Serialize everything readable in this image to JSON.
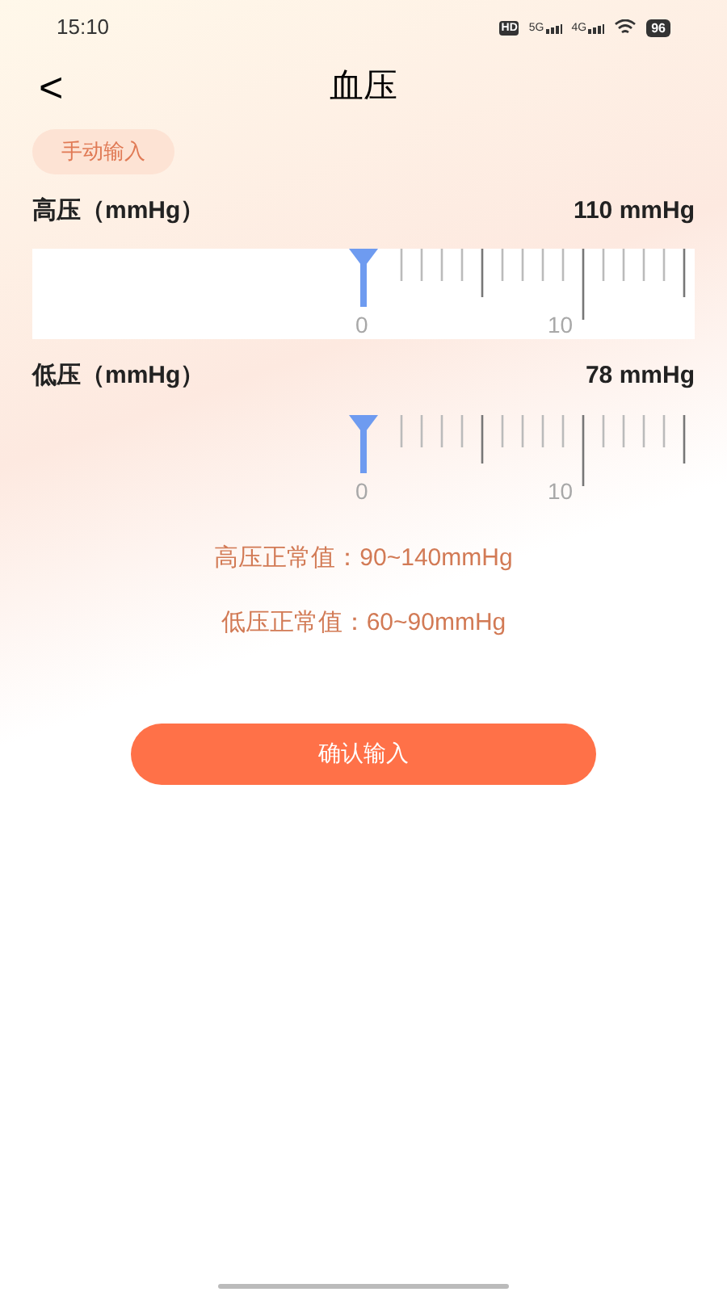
{
  "status_bar": {
    "time": "15:10",
    "hd": "HD",
    "network_1": "5G",
    "network_2": "4G",
    "battery": "96"
  },
  "header": {
    "back": "<",
    "title": "血压"
  },
  "mode_tag": "手动输入",
  "measurements": [
    {
      "label": "高压（mmHg）",
      "reading": "110 mmHg",
      "active": true,
      "ruler_labels": [
        "0",
        "10"
      ]
    },
    {
      "label": "低压（mmHg）",
      "reading": "78 mmHg",
      "active": false,
      "ruler_labels": [
        "0",
        "10"
      ]
    }
  ],
  "normal_ranges": [
    "高压正常值：90~140mmHg",
    "低压正常值：60~90mmHg"
  ],
  "confirm_button": "确认输入"
}
